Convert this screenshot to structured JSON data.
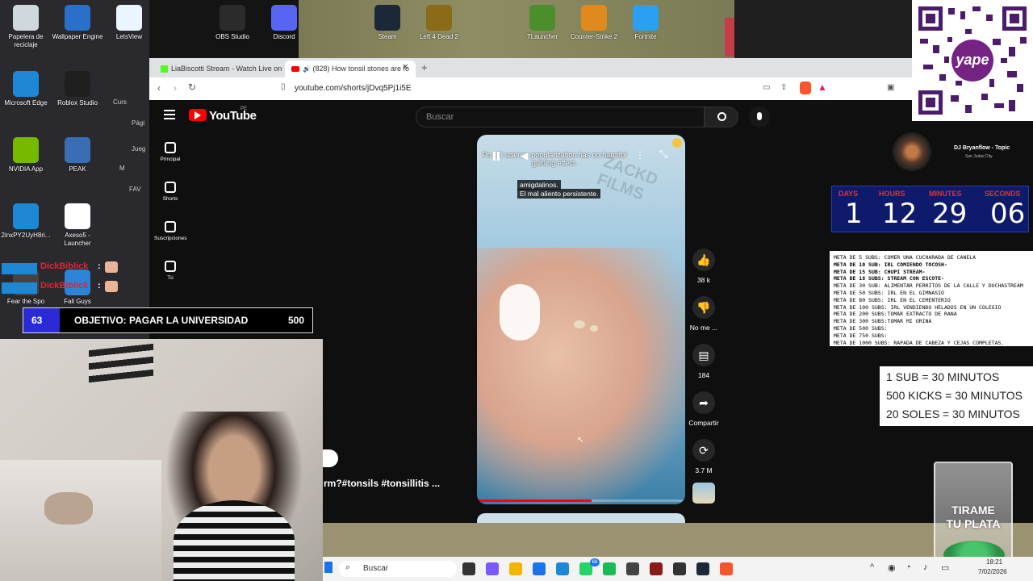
{
  "desktop": {
    "icons_left": [
      {
        "label": "Papelera de reciclaje",
        "color": "#cfd8dc"
      },
      {
        "label": "Wallpaper Engine",
        "color": "#2a6fc9"
      },
      {
        "label": "LetsView",
        "color": "#e9f6ff"
      },
      {
        "label": "Microsoft Edge",
        "color": "#1e88d6"
      },
      {
        "label": "Roblox Studio",
        "color": "#1f1f1f"
      },
      {
        "label": "NVIDIA App",
        "color": "#76b900"
      },
      {
        "label": "PEAK",
        "color": "#3a6db3"
      },
      {
        "label": "2inxPY2UyH8ri...",
        "color": "#1e88d6"
      },
      {
        "label": "Axeso5 - Launcher",
        "color": "#ffffff"
      },
      {
        "label": "Fear the Spo",
        "color": "#444"
      },
      {
        "label": "Fall Guys",
        "color": "#2c84d8"
      }
    ],
    "icons_top": [
      {
        "label": "OBS Studio",
        "color": "#2b2b2b"
      },
      {
        "label": "Discord",
        "color": "#5865f2"
      },
      {
        "label": "Steam",
        "color": "#1b2838"
      },
      {
        "label": "Left 4 Dead 2",
        "color": "#8b6a18"
      },
      {
        "label": "TLauncher",
        "color": "#4a8f2c"
      },
      {
        "label": "Counter-Strike 2",
        "color": "#e08a1e"
      },
      {
        "label": "Fortnite",
        "color": "#2aa0f0"
      }
    ],
    "partial_labels": [
      "Curs",
      "Pági",
      "Jueg",
      "M",
      "FAV"
    ]
  },
  "browser": {
    "tabs": [
      {
        "label": "LiaBiscotti Stream - Watch Live on Ki"
      },
      {
        "label": "(828) How tonsil stones are fo"
      }
    ],
    "new_tab": "+",
    "url": "youtube.com/shorts/jDvq5Pj1i5E"
  },
  "youtube": {
    "logo": "YouTube",
    "region": "PE",
    "search_placeholder": "Buscar",
    "sidebar": [
      {
        "label": "Principal",
        "icon": "home-icon"
      },
      {
        "label": "Shorts",
        "icon": "shorts-icon"
      },
      {
        "label": "Suscripciones",
        "icon": "subscriptions-icon"
      },
      {
        "label": "Tú",
        "icon": "you-icon"
      }
    ],
    "video": {
      "caption_top": "Po   3D science popularization has no harmful guiding effect.",
      "subtitle_line1": "amigdalinos.",
      "subtitle_line2": "El mal aliento persistente.",
      "watermark": "ZACKD FILMS",
      "title_partial": "rm?#tonsils #tonsillitis ...",
      "progress": 0.55
    },
    "actions": [
      {
        "label": "38 k",
        "icon": "like-icon"
      },
      {
        "label": "No me ...",
        "icon": "dislike-icon"
      },
      {
        "label": "184",
        "icon": "comment-icon"
      },
      {
        "label": "Compartir",
        "icon": "share-icon"
      },
      {
        "label": "3.7 M",
        "icon": "remix-icon"
      }
    ]
  },
  "stream": {
    "music": {
      "artist": "DJ Bryanflow - Topic",
      "subtitle": "San Judas City"
    },
    "timer": {
      "labels": [
        "DAYS",
        "HOURS",
        "MINUTES",
        "SECONDS"
      ],
      "values": [
        "1",
        "12",
        "29",
        "06"
      ]
    },
    "goals": [
      "META DE 5 SUBS: COMER UNA CUCHARADA DE CANELA",
      "META DE 10 SUB: IRL COMIENDO TOCOSH-",
      "META DE 15 SUB: CHUPI STREAM-",
      "META DE 18 SUBS: STREAM CON ESCOTE-",
      "META DE 30 SUB:  ALIMENTAR PERRITOS DE LA CALLE Y DUCHASTREAM",
      "META DE 50 SUBS: IRL EN EL GIMNASIO",
      "META DE 80 SUBS: IRL EN EL CEMENTERIO",
      "META DE 100 SUBS: IRL VENDIENDO HELADOS EN UN COLEGIO",
      "META DE 200 SUBS:TOMAR EXTRACTO DE RANA",
      "META DE 300 SUBS:TOMAR MI ORINA",
      "META DE 500 SUBS:",
      "META DE 750 SUBS:",
      "META DE 1000 SUBS: RAPADA DE CABEZA Y CEJAS COMPLETAS."
    ],
    "subinfo": [
      "1 SUB = 30 MINUTOS",
      "500 KICKS = 30 MINUTOS",
      "20 SOLES = 30 MINUTOS"
    ],
    "tip_jar": [
      "TIRAME",
      "TU PLATA"
    ],
    "qr_label": "yape",
    "objective": {
      "current": "63",
      "label": "OBJETIVO: PAGAR LA UNIVERSIDAD",
      "target": "500",
      "fraction": 0.126
    },
    "chat": [
      {
        "user": "DickBiblick",
        "sep": ":"
      },
      {
        "user": "DickBiblick",
        "sep": ":"
      }
    ]
  },
  "taskbar": {
    "search_placeholder": "Buscar",
    "badge": "68",
    "time": "18:21",
    "date": "7/02/2026"
  }
}
